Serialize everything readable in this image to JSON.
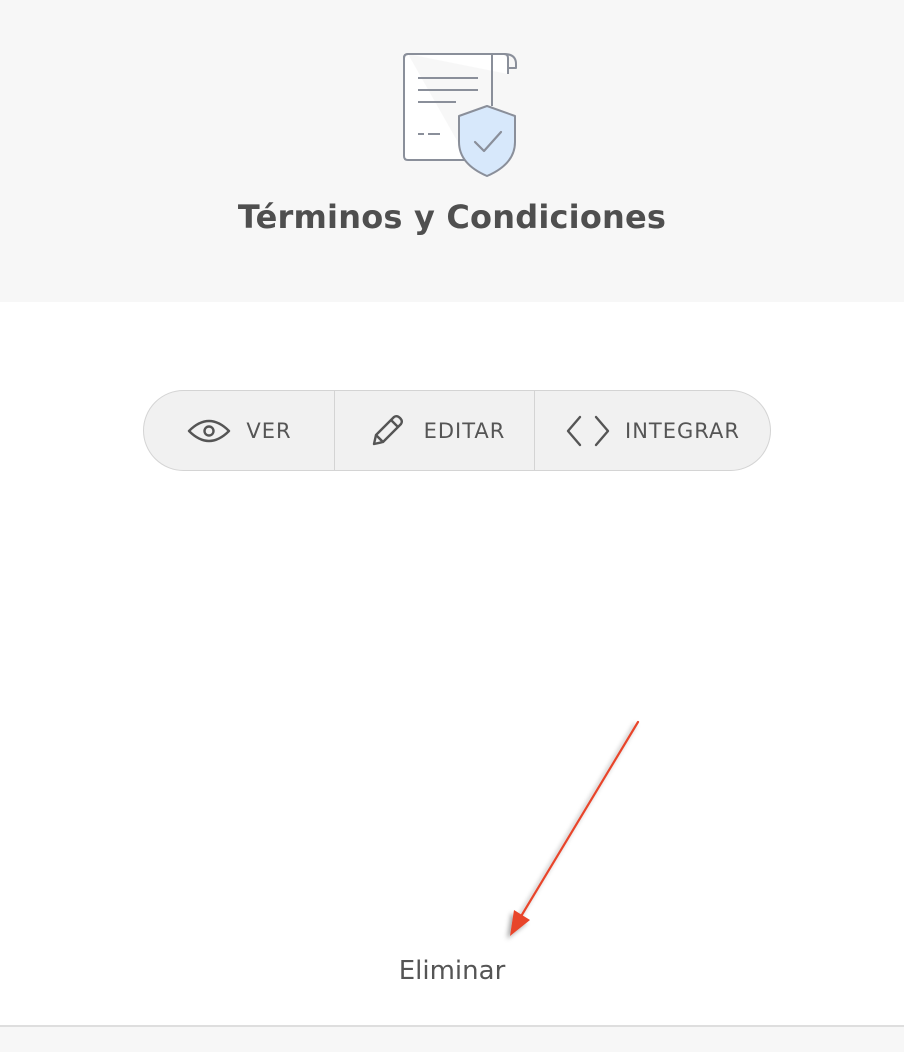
{
  "header": {
    "title": "Términos y Condiciones",
    "icon": "document-shield-icon"
  },
  "actions": [
    {
      "label": "VER",
      "icon": "eye-icon"
    },
    {
      "label": "EDITAR",
      "icon": "pencil-icon"
    },
    {
      "label": "INTEGRAR",
      "icon": "code-icon"
    }
  ],
  "footer": {
    "delete_label": "Eliminar"
  },
  "annotation": {
    "type": "arrow",
    "color": "#e8442c"
  },
  "colors": {
    "header_bg": "#f7f7f7",
    "text": "#4f4f4f",
    "shield_fill": "#d7e8fb",
    "icon_stroke": "#8a8f9a"
  }
}
